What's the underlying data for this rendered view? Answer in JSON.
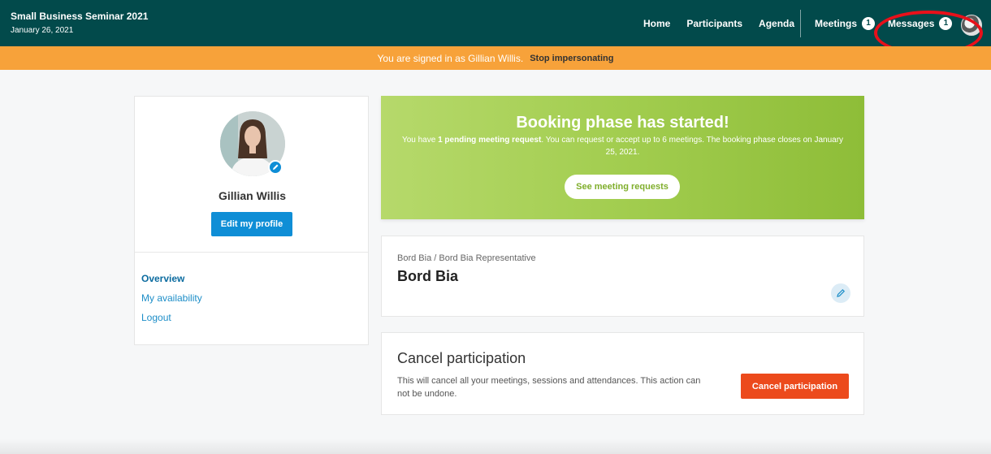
{
  "header": {
    "event_title": "Small Business Seminar 2021",
    "event_date": "January 26, 2021",
    "nav": {
      "home": "Home",
      "participants": "Participants",
      "agenda": "Agenda",
      "meetings": "Meetings",
      "meetings_count": "1",
      "messages": "Messages",
      "messages_count": "1"
    }
  },
  "impersonation": {
    "message": "You are signed in as Gillian Willis.",
    "stop_label": "Stop impersonating"
  },
  "profile": {
    "name": "Gillian Willis",
    "edit_label": "Edit my profile",
    "links": [
      "Overview",
      "My availability",
      "Logout"
    ]
  },
  "booking": {
    "title": "Booking phase has started!",
    "text_prefix": "You have",
    "text_bold": "1 pending meeting request",
    "text_suffix": ". You can request or accept up to 6 meetings. The booking phase closes on January 25, 2021.",
    "button_label": "See meeting requests"
  },
  "organization": {
    "subtitle": "Bord Bia / Bord Bia Representative",
    "name": "Bord Bia"
  },
  "cancel": {
    "title": "Cancel participation",
    "description": "This will cancel all your meetings, sessions and attendances. This action can not be undone.",
    "button_label": "Cancel participation"
  },
  "colors": {
    "header_bg": "#024a4b",
    "impersonation_bg": "#f7a23a",
    "primary_blue": "#0f8ed6",
    "banner_green": "#a2cd4f",
    "cancel_red": "#ec4a1c",
    "highlight_ring": "#e8101a"
  }
}
